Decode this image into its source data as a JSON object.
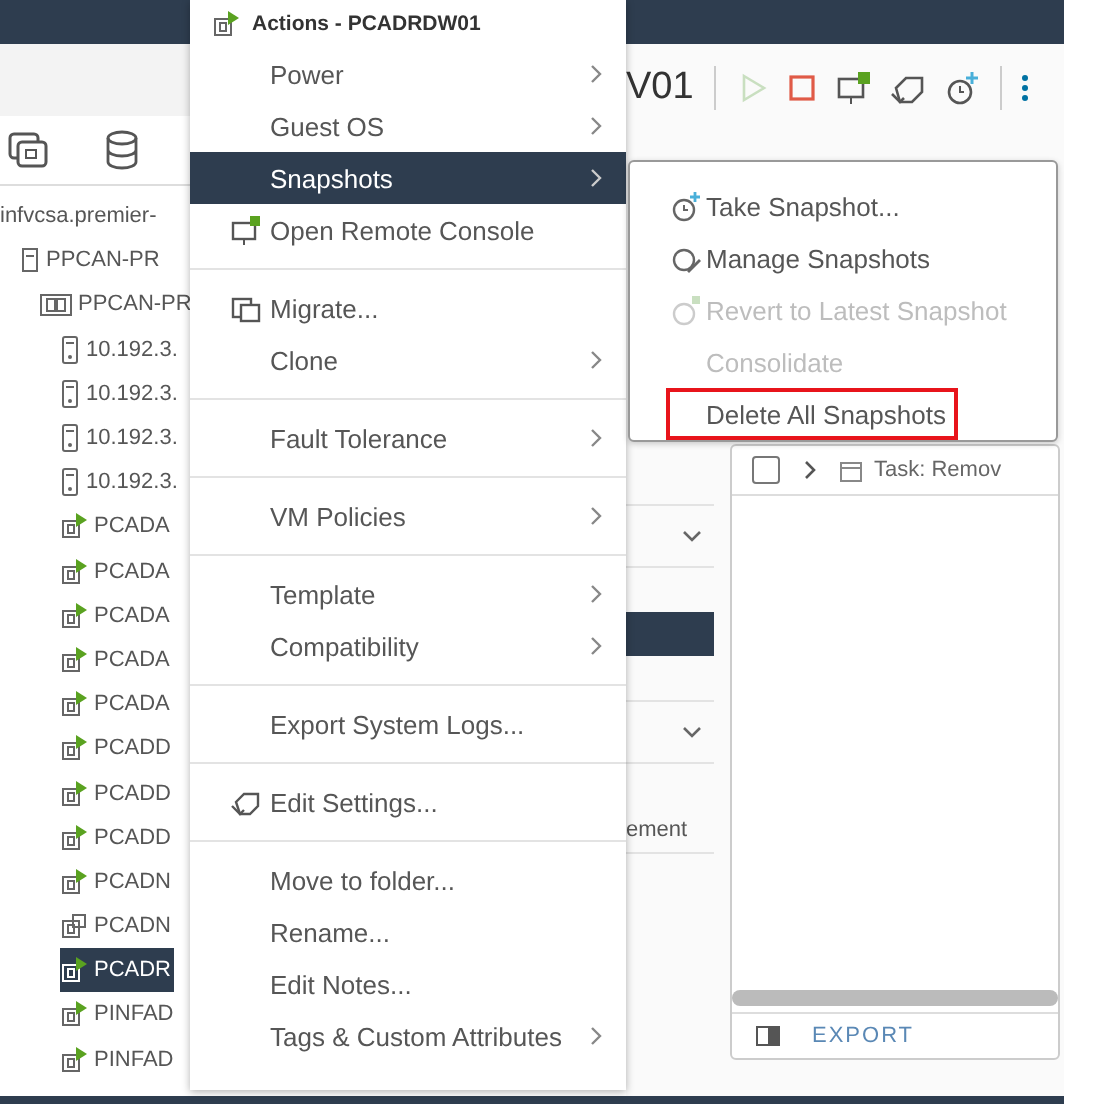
{
  "tree": [
    {
      "label": "infvcsa.premier-",
      "selected": false,
      "children": [
        {
          "label": "PPCAN-PR",
          "kind": "datacenter",
          "selected": false,
          "children": [
            {
              "label": "PPCAN-PR",
              "kind": "cluster",
              "selected": false,
              "children": [
                {
                  "label": "10.192.3.",
                  "kind": "host",
                  "selected": false
                },
                {
                  "label": "10.192.3.",
                  "kind": "host",
                  "selected": false
                },
                {
                  "label": "10.192.3.",
                  "kind": "host",
                  "selected": false
                },
                {
                  "label": "10.192.3.",
                  "kind": "host",
                  "selected": false
                },
                {
                  "label": "PCADA",
                  "kind": "vm",
                  "powered_on": true,
                  "selected": false
                },
                {
                  "label": "PCADA",
                  "kind": "vm",
                  "powered_on": true,
                  "selected": false
                },
                {
                  "label": "PCADA",
                  "kind": "vm",
                  "powered_on": true,
                  "selected": false
                },
                {
                  "label": "PCADA",
                  "kind": "vm",
                  "powered_on": true,
                  "selected": false
                },
                {
                  "label": "PCADA",
                  "kind": "vm",
                  "powered_on": true,
                  "selected": false
                },
                {
                  "label": "PCADD",
                  "kind": "vm",
                  "powered_on": true,
                  "selected": false
                },
                {
                  "label": "PCADD",
                  "kind": "vm",
                  "powered_on": true,
                  "selected": false
                },
                {
                  "label": "PCADD",
                  "kind": "vm",
                  "powered_on": true,
                  "selected": false
                },
                {
                  "label": "PCADN",
                  "kind": "vm",
                  "powered_on": true,
                  "selected": false
                },
                {
                  "label": "PCADN",
                  "kind": "vm",
                  "powered_on": false,
                  "selected": false
                },
                {
                  "label": "PCADR",
                  "kind": "vm",
                  "powered_on": true,
                  "selected": true
                },
                {
                  "label": "PINFAD",
                  "kind": "vm",
                  "powered_on": true,
                  "selected": false
                },
                {
                  "label": "PINFAD",
                  "kind": "vm",
                  "powered_on": true,
                  "selected": false
                }
              ]
            }
          ]
        }
      ]
    }
  ],
  "object": {
    "title": "V01",
    "toolbar": [
      {
        "kind": "power_on",
        "disabled": true
      },
      {
        "kind": "power_off",
        "disabled": false
      },
      {
        "kind": "console",
        "disabled": false
      },
      {
        "kind": "settings",
        "disabled": false
      },
      {
        "kind": "snapshot",
        "disabled": false
      }
    ]
  },
  "side_column": [
    {
      "kind": "header"
    },
    {
      "kind": "item",
      "selected": true
    },
    {
      "kind": "header"
    },
    {
      "kind": "text",
      "label": "ement"
    }
  ],
  "tasks": {
    "rows": [
      {
        "label": "Task: Remov",
        "checked": false
      }
    ],
    "footer_button": "EXPORT"
  },
  "actions_menu": {
    "title": "Actions - PCADRDW01",
    "groups": [
      [
        {
          "label": "Power",
          "submenu": true,
          "selected": false
        },
        {
          "label": "Guest OS",
          "submenu": true,
          "selected": false
        },
        {
          "label": "Snapshots",
          "submenu": true,
          "selected": true
        },
        {
          "label": "Open Remote Console",
          "kind": "console",
          "submenu": false,
          "selected": false
        }
      ],
      [
        {
          "label": "Migrate...",
          "kind": "migrate",
          "submenu": false,
          "selected": false
        },
        {
          "label": "Clone",
          "submenu": true,
          "selected": false
        }
      ],
      [
        {
          "label": "Fault Tolerance",
          "submenu": true,
          "selected": false
        }
      ],
      [
        {
          "label": "VM Policies",
          "submenu": true,
          "selected": false
        }
      ],
      [
        {
          "label": "Template",
          "submenu": true,
          "selected": false
        },
        {
          "label": "Compatibility",
          "submenu": true,
          "selected": false
        }
      ],
      [
        {
          "label": "Export System Logs...",
          "submenu": false,
          "selected": false
        }
      ],
      [
        {
          "label": "Edit Settings...",
          "kind": "settings",
          "submenu": false,
          "selected": false
        }
      ],
      [
        {
          "label": "Move to folder...",
          "submenu": false,
          "selected": false
        },
        {
          "label": "Rename...",
          "submenu": false,
          "selected": false
        },
        {
          "label": "Edit Notes...",
          "submenu": false,
          "selected": false
        },
        {
          "label": "Tags & Custom Attributes",
          "submenu": true,
          "selected": false
        }
      ]
    ]
  },
  "snapshots_submenu": {
    "items": [
      {
        "label": "Take Snapshot...",
        "kind": "take",
        "disabled": false,
        "highlighted": false
      },
      {
        "label": "Manage Snapshots",
        "kind": "manage",
        "disabled": false,
        "highlighted": false
      },
      {
        "label": "Revert to Latest Snapshot",
        "kind": "revert",
        "disabled": true,
        "highlighted": false
      },
      {
        "label": "Consolidate",
        "disabled": true,
        "highlighted": false
      },
      {
        "label": "Delete All Snapshots",
        "disabled": false,
        "highlighted": true
      }
    ]
  }
}
